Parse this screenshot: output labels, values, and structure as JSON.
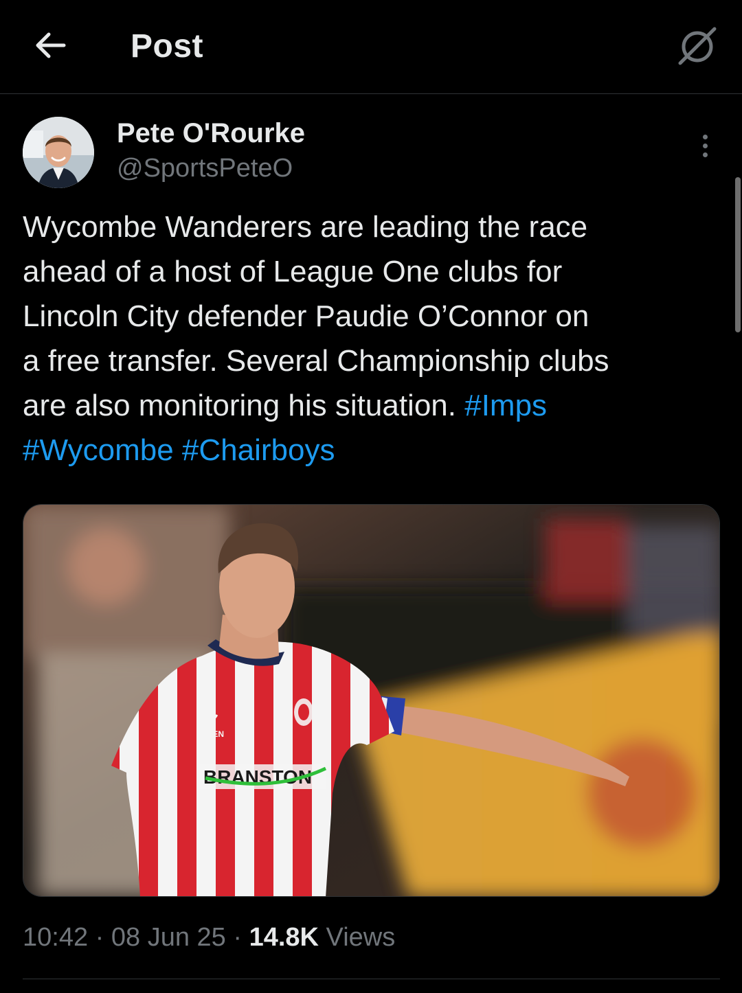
{
  "header": {
    "title": "Post",
    "back_icon": "arrow-left-icon",
    "grok_icon": "grok-icon"
  },
  "author": {
    "name": "Pete O'Rourke",
    "handle": "@SportsPeteO"
  },
  "post": {
    "text_lines": [
      "Wycombe Wanderers are leading the race",
      "ahead of a host of League One clubs for",
      "Lincoln City defender Paudie O’Connor on",
      "a free transfer. Several Championship clubs",
      "are also monitoring his situation."
    ],
    "hashtags": [
      "#Imps",
      "#Wycombe",
      "#Chairboys"
    ],
    "media_jersey_text": {
      "sponsor": "BRANSTON",
      "kit_maker": "OXEN"
    }
  },
  "meta": {
    "time": "10:42",
    "date": "08 Jun 25",
    "separator": "·",
    "views_count": "14.8K",
    "views_label": "Views"
  },
  "colors": {
    "background": "#000000",
    "text": "#e7e9ea",
    "secondary": "#71767b",
    "link": "#1d9bf0",
    "border": "#2f3336"
  }
}
